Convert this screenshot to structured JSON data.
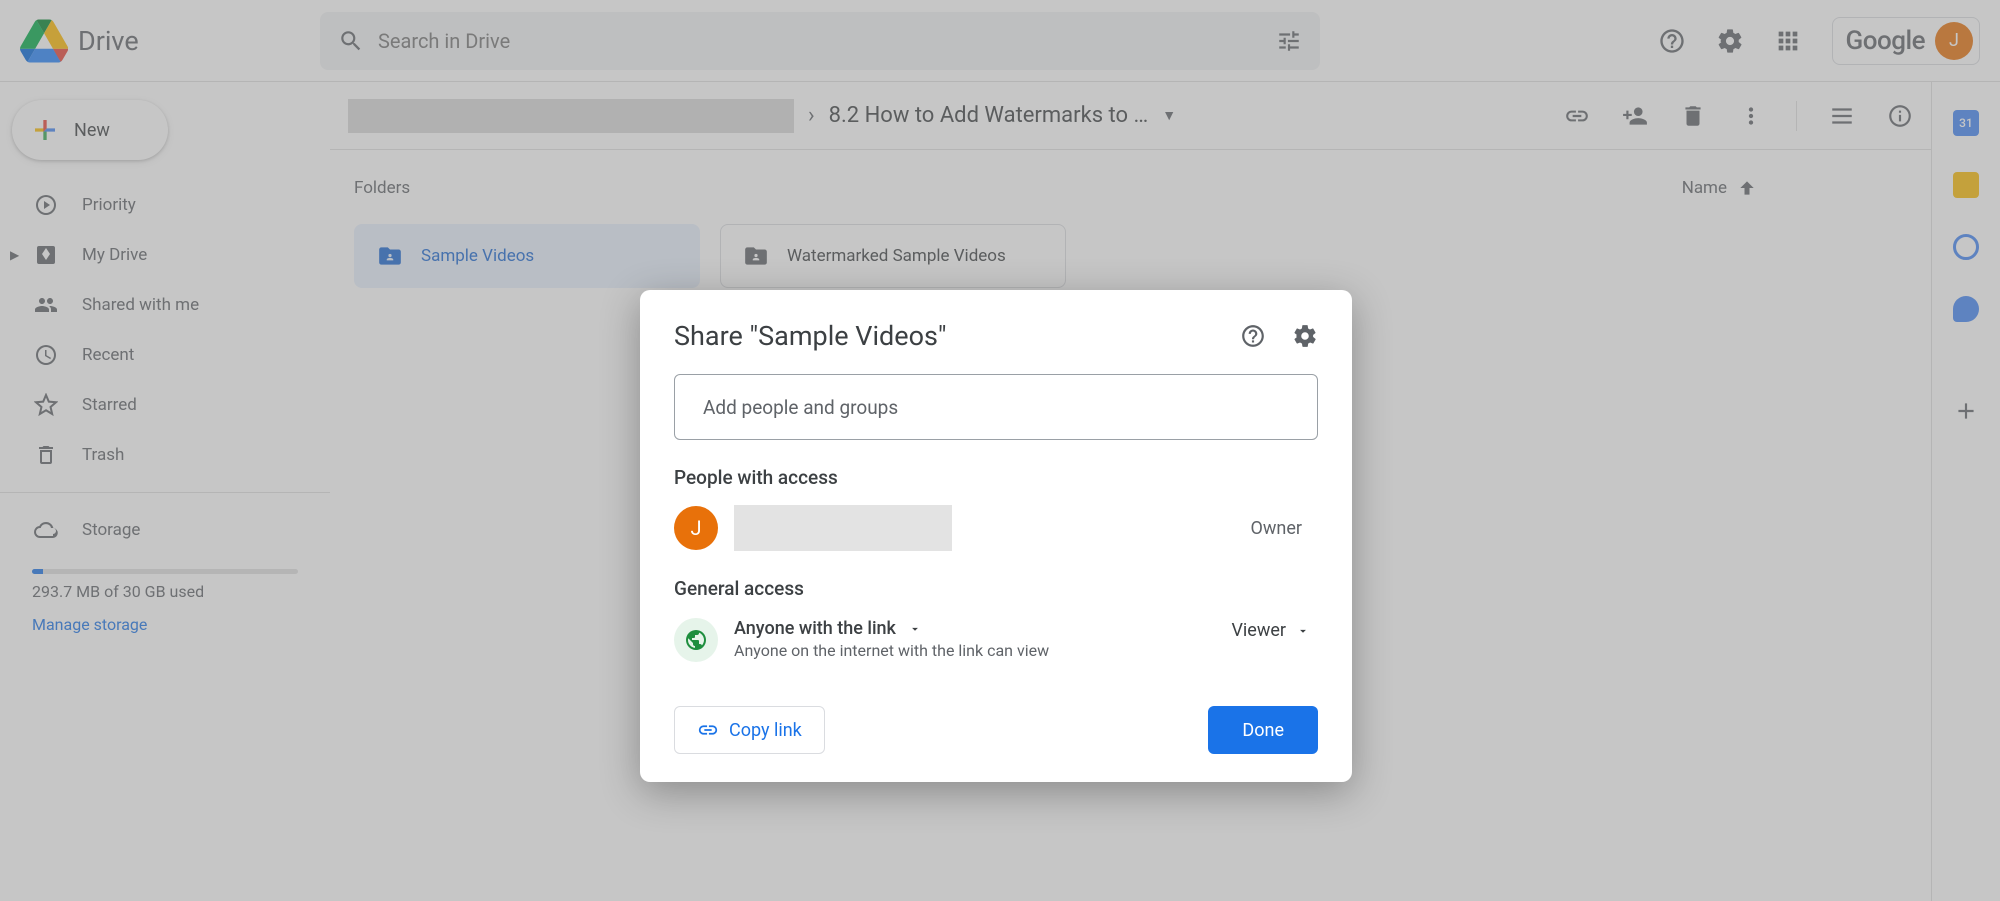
{
  "app": {
    "name": "Drive"
  },
  "search": {
    "placeholder": "Search in Drive"
  },
  "header": {
    "google": "Google",
    "avatar_initial": "J"
  },
  "sidebar": {
    "new_label": "New",
    "items": [
      {
        "label": "Priority"
      },
      {
        "label": "My Drive"
      },
      {
        "label": "Shared with me"
      },
      {
        "label": "Recent"
      },
      {
        "label": "Starred"
      },
      {
        "label": "Trash"
      }
    ],
    "storage_label": "Storage",
    "storage_used": "293.7 MB of 30 GB used",
    "manage": "Manage storage"
  },
  "crumb": {
    "title": "8.2 How to Add Watermarks to …"
  },
  "files": {
    "section": "Folders",
    "sort_label": "Name",
    "folders": [
      {
        "label": "Sample Videos",
        "selected": true
      },
      {
        "label": "Watermarked Sample Videos",
        "selected": false
      }
    ]
  },
  "dialog": {
    "title": "Share \"Sample Videos\"",
    "add_placeholder": "Add people and groups",
    "people_heading": "People with access",
    "person_initial": "J",
    "owner": "Owner",
    "general_heading": "General access",
    "access_title": "Anyone with the link",
    "access_sub": "Anyone on the internet with the link can view",
    "viewer": "Viewer",
    "copy": "Copy link",
    "done": "Done"
  },
  "sidepanel": {
    "calendar_day": "31"
  }
}
